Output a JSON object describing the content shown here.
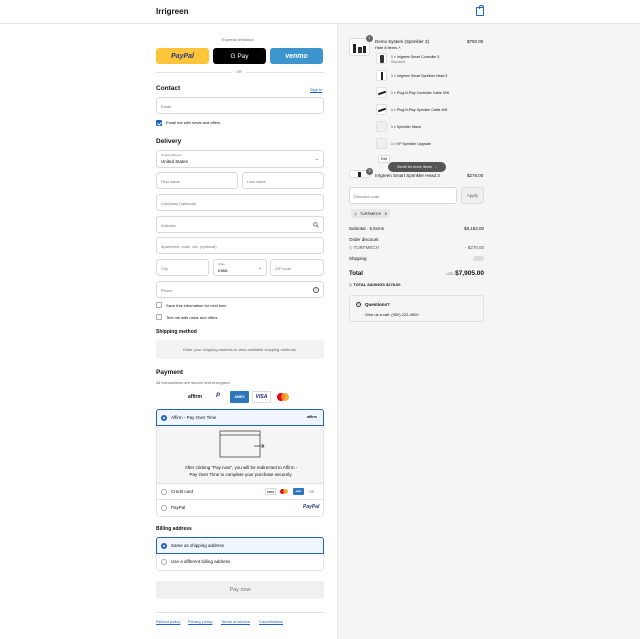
{
  "header": {
    "brand": "Irrigreen",
    "cart_icon": "shopping-bag-icon"
  },
  "express": {
    "title": "Express checkout",
    "paypal": "PayPal",
    "gpay": "G Pay",
    "venmo": "venmo",
    "or": "OR"
  },
  "contact": {
    "heading": "Contact",
    "sign_in": "Sign in",
    "email_placeholder": "Email",
    "news_label": "Email me with news and offers",
    "news_checked": true
  },
  "delivery": {
    "heading": "Delivery",
    "country_label": "Country/Region",
    "country_value": "United States",
    "first_name": "First name",
    "last_name": "Last name",
    "company": "Company (optional)",
    "address": "Address",
    "apartment": "Apartment, suite, etc. (optional)",
    "city": "City",
    "state_label": "State",
    "state_value": "Iowa",
    "zip": "ZIP code",
    "phone": "Phone",
    "save_info": "Save this information for next time",
    "text_me": "Text me with news and offers"
  },
  "shipping_method": {
    "heading": "Shipping method",
    "note": "Enter your shipping address to view available shipping methods."
  },
  "payment": {
    "heading": "Payment",
    "subtitle": "All transactions are secure and encrypted.",
    "brands": [
      "affirm",
      "P",
      "AMEX",
      "VISA",
      "MC"
    ],
    "affirm_label": "Affirm - Pay Over Time",
    "affirm_logo": "affirm",
    "affirm_note": "After clicking \"Pay now\", you will be redirected to Affirm - Pay Over Time to complete your purchase securely.",
    "credit_card": "Credit card",
    "card_more": "+3",
    "paypal": "PayPal",
    "paypal_logo": "PayPal"
  },
  "billing": {
    "heading": "Billing address",
    "same": "Same as shipping address",
    "different": "Use a different billing address"
  },
  "pay_now": "Pay now",
  "footer_links": [
    "Refund policy",
    "Privacy policy",
    "Terms of service",
    "Cancellations"
  ],
  "order": {
    "bundle_qty": "1",
    "bundle_name": "Demo System (Sprinkler 3)",
    "bundle_price": "$750.00",
    "hide_items": "Hide 8 items",
    "sub_items": [
      {
        "label": "1 × Irrigreen Smart Controller 3",
        "sub": "Standard"
      },
      {
        "label": "1 × Irrigreen Smart Sprinkler Head 3",
        "sub": ""
      },
      {
        "label": "1 × Plug-N-Play Controller Cable 50ft",
        "sub": ""
      },
      {
        "label": "1 × Plug-N-Play Sprinkler Cable 40ft",
        "sub": ""
      },
      {
        "label": "1 × Sprinkler Stand",
        "sub": ""
      },
      {
        "label": "1 × XP Sprinkler Upgrade",
        "sub": ""
      }
    ],
    "edit": "Edit",
    "scroll_more": "Scroll for more items",
    "second_qty": "3",
    "second_name": "Irrigreen Smart Sprinkler Head 3",
    "second_price": "$278.00",
    "discount_placeholder": "Discount code",
    "apply": "Apply",
    "code_tag": "TURFMECH",
    "subtotal_label": "Subtotal · 5 items",
    "subtotal_value": "$8,183.00",
    "order_discount": "Order discount",
    "discount_code": "TURFMECH",
    "discount_value": "- $278.00",
    "shipping_label": "Shipping",
    "total_label": "Total",
    "currency": "USD",
    "total_value": "$7,905.00",
    "savings_label": "TOTAL SAVINGS",
    "savings_value": "$278.00",
    "questions_title": "Questions?",
    "questions_body": "Give us a call: (952) 222-4900"
  },
  "colors": {
    "accent": "#1d62c9",
    "paypal_yellow": "#ffc439",
    "venmo_blue": "#3d95ce",
    "amex": "#2e77bc"
  }
}
